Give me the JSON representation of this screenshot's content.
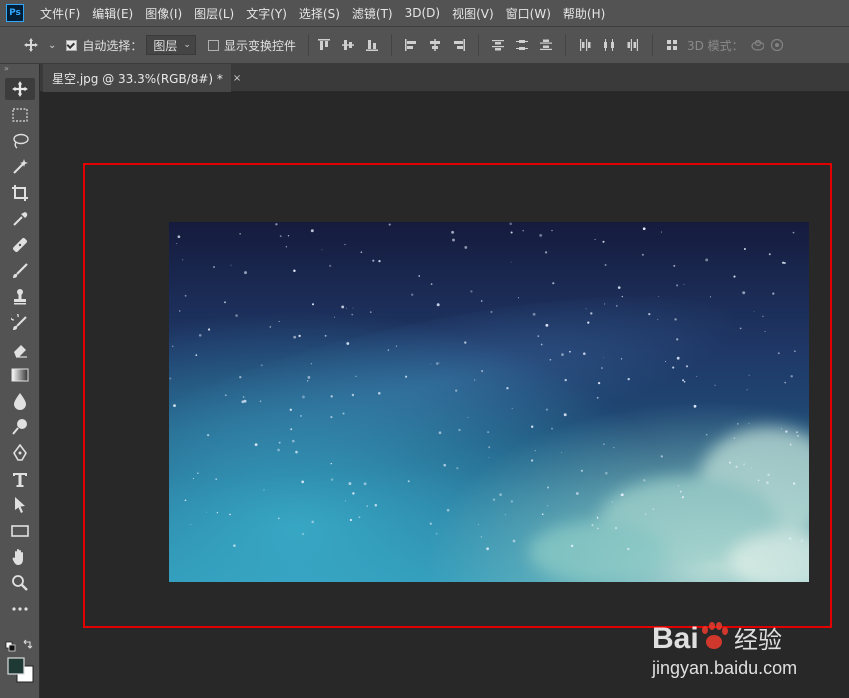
{
  "app": {
    "logo": "Ps"
  },
  "menu": [
    "文件(F)",
    "编辑(E)",
    "图像(I)",
    "图层(L)",
    "文字(Y)",
    "选择(S)",
    "滤镜(T)",
    "3D(D)",
    "视图(V)",
    "窗口(W)",
    "帮助(H)"
  ],
  "options": {
    "auto_select_label": "自动选择：",
    "auto_select_checked": true,
    "target_value": "图层",
    "show_transform_label": "显示变换控件",
    "show_transform_checked": false,
    "mode_3d_label": "3D 模式："
  },
  "document": {
    "tab_title": "星空.jpg @ 33.3%(RGB/8#) *",
    "tab_close": "×"
  },
  "colors": {
    "highlight": "#e00000",
    "foreground": "#1f3a35",
    "background": "#ffffff"
  },
  "watermark": {
    "brand": "Bai",
    "brand_suffix": "经验",
    "url": "jingyan.baidu.com"
  }
}
